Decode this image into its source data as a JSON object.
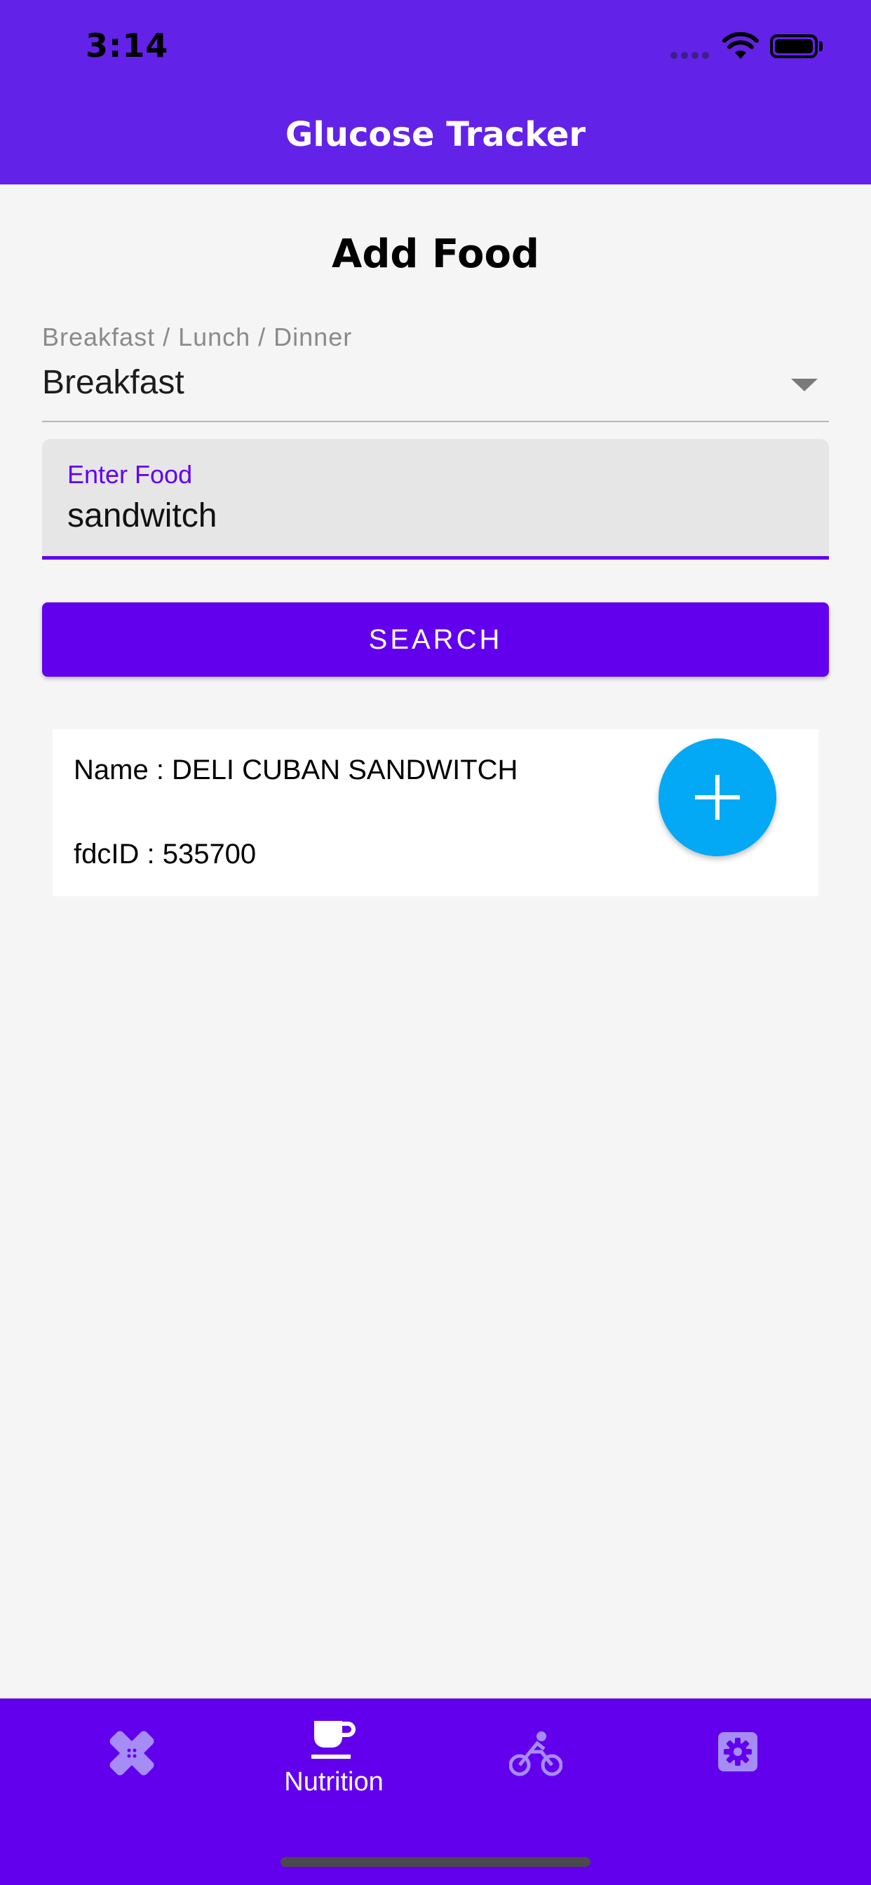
{
  "status_bar": {
    "time": "3:14"
  },
  "app_bar": {
    "title": "Glucose Tracker",
    "color": "#6322e8"
  },
  "page": {
    "title": "Add Food"
  },
  "meal_select": {
    "label": "Breakfast / Lunch / Dinner",
    "value": "Breakfast"
  },
  "food_input": {
    "label": "Enter Food",
    "value": "sandwitch"
  },
  "search_button": {
    "label": "SEARCH"
  },
  "results": [
    {
      "name": "Name : DELI CUBAN SANDWITCH",
      "fdc_id": "fdcID : 535700",
      "add_icon": "plus-icon"
    }
  ],
  "tab_bar": {
    "tabs": [
      {
        "icon": "bandage-icon",
        "label": "",
        "active": false
      },
      {
        "icon": "coffee-cup-icon",
        "label": "Nutrition",
        "active": true
      },
      {
        "icon": "bicycle-rider-icon",
        "label": "",
        "active": false
      },
      {
        "icon": "gear-icon",
        "label": "",
        "active": false
      }
    ]
  },
  "colors": {
    "primary": "#6200ee",
    "fab": "#03a9f4",
    "background": "#f5f5f5",
    "inactive_icon": "#a68cf5"
  }
}
